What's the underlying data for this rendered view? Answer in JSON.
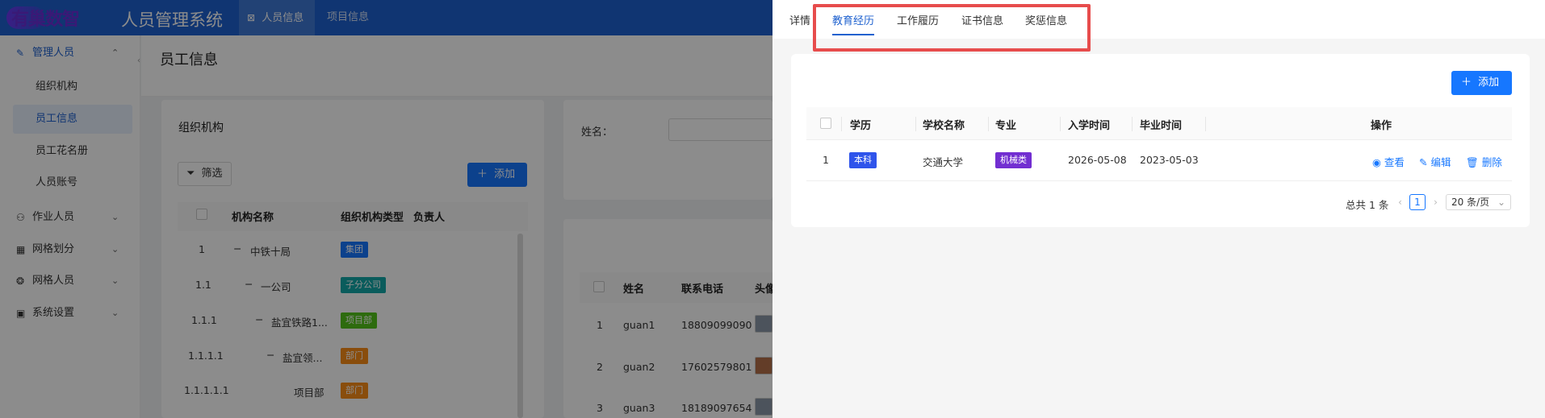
{
  "header": {
    "logo_text": "有巢数智",
    "system_title": "人员管理系统",
    "nav": [
      {
        "label": "人员信息",
        "icon": "grid-icon"
      },
      {
        "label": "项目信息"
      }
    ]
  },
  "sidebar": {
    "items": [
      {
        "label": "管理人员",
        "icon": "file-edit-icon",
        "expanded": true
      },
      {
        "label": "组织机构"
      },
      {
        "label": "员工信息"
      },
      {
        "label": "员工花名册"
      },
      {
        "label": "人员账号"
      },
      {
        "label": "作业人员",
        "icon": "user-icon"
      },
      {
        "label": "网格划分",
        "icon": "table-icon"
      },
      {
        "label": "网格人员",
        "icon": "network-icon"
      },
      {
        "label": "系统设置",
        "icon": "settings-box-icon"
      }
    ]
  },
  "page": {
    "title": "员工信息"
  },
  "org_card": {
    "title": "组织机构",
    "filter_label": "筛选",
    "add_label": "添加",
    "columns": [
      "机构名称",
      "组织机构类型",
      "负责人"
    ],
    "rows": [
      {
        "index": "1",
        "name": "中铁十局",
        "type": "集团",
        "type_color": "#1677ff"
      },
      {
        "index": "1.1",
        "name": "一公司",
        "type": "子分公司",
        "type_color": "#13a8a8"
      },
      {
        "index": "1.1.1",
        "name": "盐宜铁路1...",
        "type": "项目部",
        "type_color": "#52c41a"
      },
      {
        "index": "1.1.1.1",
        "name": "盐宜领...",
        "type": "部门",
        "type_color": "#fa8c16"
      },
      {
        "index": "1.1.1.1.1",
        "name": "项目部",
        "type": "部门",
        "type_color": "#fa8c16"
      }
    ]
  },
  "staff_card": {
    "search_label": "姓名：",
    "columns": [
      "姓名",
      "联系电话",
      "头像"
    ],
    "rows": [
      {
        "index": "1",
        "name": "guan1",
        "phone": "18809099090"
      },
      {
        "index": "2",
        "name": "guan2",
        "phone": "17602579801"
      },
      {
        "index": "3",
        "name": "guan3",
        "phone": "18189097654"
      }
    ]
  },
  "drawer": {
    "tabs": [
      {
        "label": "详情"
      },
      {
        "label": "教育经历",
        "active": true
      },
      {
        "label": "工作履历"
      },
      {
        "label": "证书信息"
      },
      {
        "label": "奖惩信息"
      }
    ],
    "add_label": "添加",
    "columns": [
      "学历",
      "学校名称",
      "专业",
      "入学时间",
      "毕业时间",
      "操作"
    ],
    "rows": [
      {
        "index": "1",
        "degree": "本科",
        "degree_color": "#2f54eb",
        "school": "交通大学",
        "major": "机械类",
        "major_color": "#722ed1",
        "enroll": "2026-05-08",
        "graduate": "2023-05-03",
        "actions": {
          "view": "查看",
          "edit": "编辑",
          "delete": "删除"
        }
      }
    ],
    "pagination": {
      "total": "总共 1 条",
      "current": "1",
      "page_size": "20 条/页"
    }
  },
  "colors": {
    "primary": "#1677ff",
    "header": "#1e61cf",
    "highlight_box": "#e74c4c"
  }
}
